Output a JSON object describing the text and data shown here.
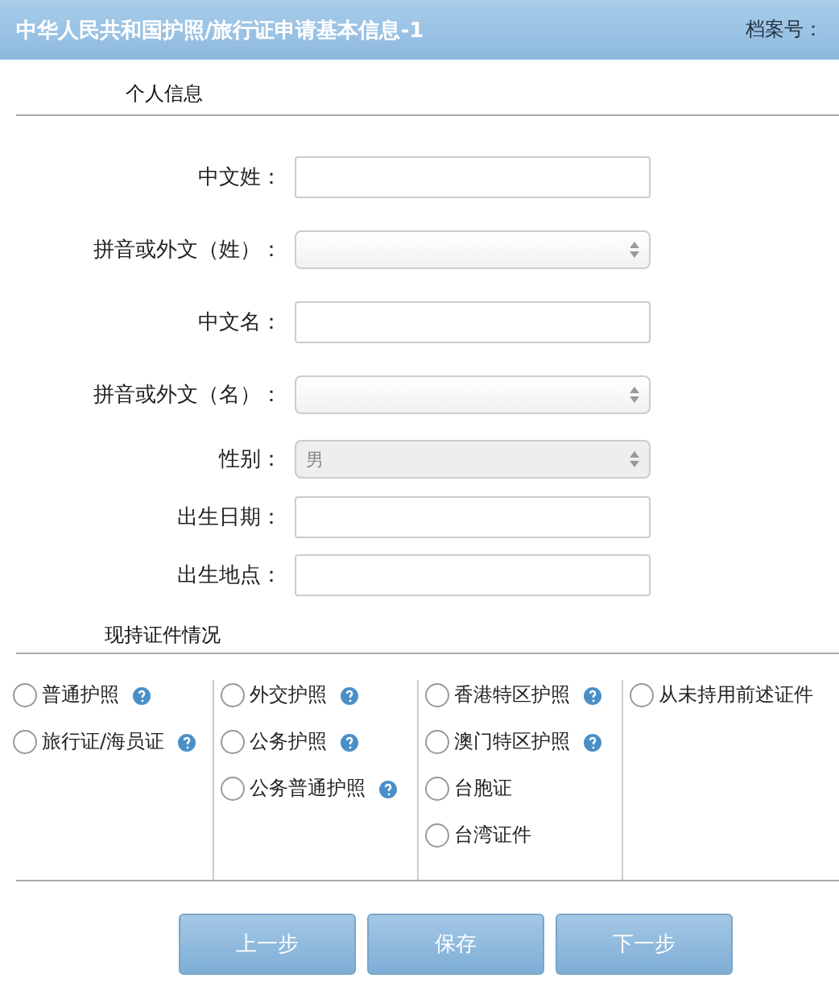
{
  "header": {
    "title": "中华人民共和国护照/旅行证申请基本信息-1",
    "file_label": "档案号："
  },
  "section_personal": "个人信息",
  "fields": [
    {
      "label": "中文姓：",
      "kind": "text"
    },
    {
      "label": "拼音或外文（姓）：",
      "kind": "select"
    },
    {
      "label": "中文名：",
      "kind": "text"
    },
    {
      "label": "拼音或外文（名）：",
      "kind": "select"
    },
    {
      "label": "性别：",
      "kind": "select",
      "value": "男"
    },
    {
      "label": "出生日期：",
      "kind": "text"
    },
    {
      "label": "出生地点：",
      "kind": "text"
    }
  ],
  "section_documents": "现持证件情况",
  "document_columns": [
    [
      {
        "label": "普通护照",
        "help": true,
        "selected": false
      },
      {
        "label": "旅行证/海员证",
        "help": true,
        "selected": false
      }
    ],
    [
      {
        "label": "外交护照",
        "help": true,
        "selected": false
      },
      {
        "label": "公务护照",
        "help": true,
        "selected": false
      },
      {
        "label": "公务普通护照",
        "help": true,
        "selected": false
      }
    ],
    [
      {
        "label": "香港特区护照",
        "help": true,
        "selected": false
      },
      {
        "label": "澳门特区护照",
        "help": true,
        "selected": false
      },
      {
        "label": "台胞证",
        "help": false,
        "selected": false
      },
      {
        "label": "台湾证件",
        "help": false,
        "selected": false
      }
    ],
    [
      {
        "label": "从未持用前述证件",
        "help": false,
        "selected": false
      }
    ]
  ],
  "buttons": [
    "上一步",
    "保存",
    "下一步"
  ]
}
